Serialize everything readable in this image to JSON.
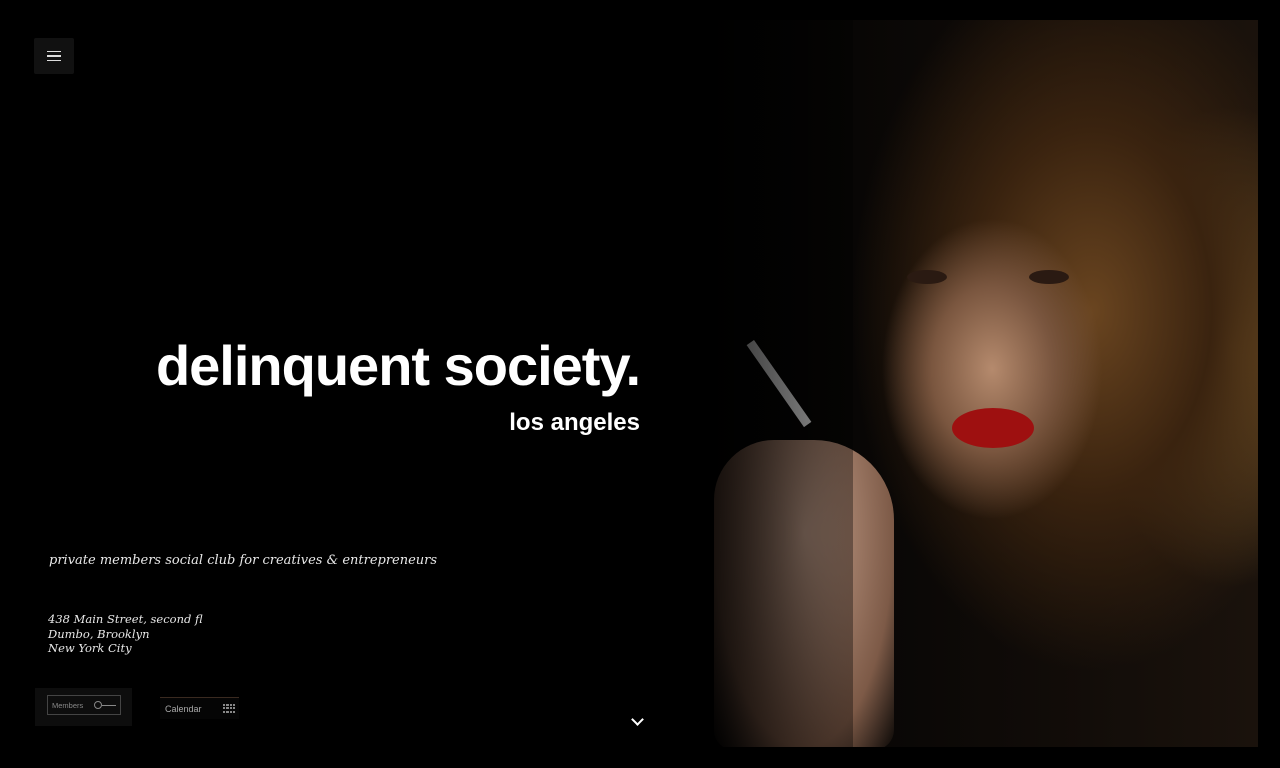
{
  "brand": {
    "name": "delinquent society.",
    "city": "los angeles"
  },
  "tagline": "private members social club for creatives & entrepreneurs",
  "address": {
    "line1": "438 Main Street, second fl",
    "line2": "Dumbo, Brooklyn",
    "line3": "New York City"
  },
  "buttons": {
    "members_label": "Members",
    "members_icon": "key-icon",
    "calendar_label": "Calendar",
    "calendar_icon": "grid-icon",
    "menu_icon": "hamburger-icon",
    "scroll_icon": "chevron-down-icon"
  },
  "colors": {
    "background": "#000000",
    "text": "#ffffff",
    "lips": "#9e1010"
  }
}
